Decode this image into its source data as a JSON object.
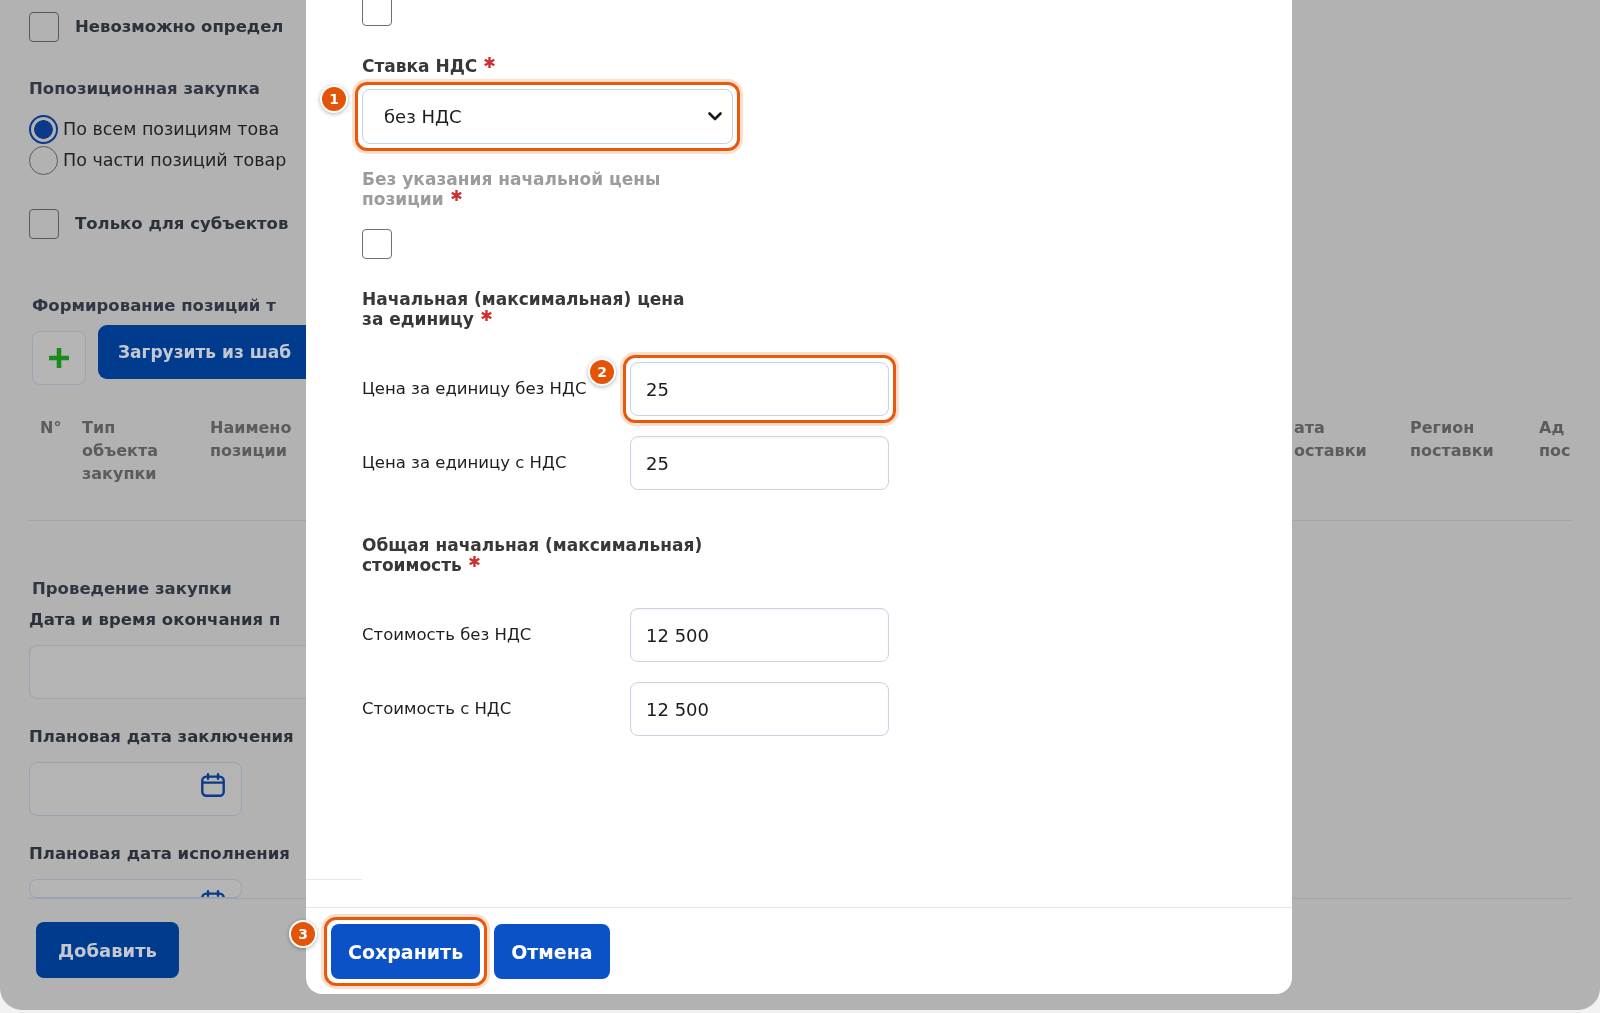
{
  "page": {
    "determination_checkbox": {
      "label": "Невозможно определ",
      "checked": false
    },
    "positional_purchase": {
      "title": "Попозиционная закупка",
      "options": [
        {
          "label": "По всем позициям това",
          "selected": true
        },
        {
          "label": "По части позиций товар",
          "selected": false
        }
      ]
    },
    "smb_checkbox": {
      "label": "Только для субъектов",
      "checked": false
    },
    "positions": {
      "title": "Формирование позиций т",
      "template_button": "Загрузить из шаб",
      "table": {
        "columns": [
          "N°",
          "Тип объекта закупки",
          "Наимено позиции",
          "ата оставки",
          "Регион поставки",
          "Ад пос"
        ]
      }
    },
    "procedure": {
      "title": "Проведение закупки",
      "fields": [
        {
          "kind": "datetime",
          "label": "Дата и время окончания п"
        },
        {
          "kind": "date",
          "label": "Плановая дата заключения"
        },
        {
          "kind": "date",
          "label": "Плановая дата исполнения"
        }
      ]
    },
    "add_button": "Добавить"
  },
  "modal": {
    "fields": [
      {
        "kind": "checkbox",
        "checked": false,
        "disabled": false
      },
      {
        "kind": "select",
        "label": "Ставка НДС",
        "required": true,
        "value": "без НДС",
        "highlighted": true,
        "badge": "1"
      },
      {
        "kind": "checkbox",
        "label": "Без указания начальной цены позиции",
        "required": true,
        "disabled": true,
        "checked": false
      },
      {
        "kind": "group",
        "label": "Начальная (максимальная) цена за единицу",
        "required": true,
        "rows": [
          {
            "label": "Цена за единицу без НДС",
            "value": "25",
            "highlighted": true,
            "badge": "2"
          },
          {
            "label": "Цена за единицу с НДС",
            "value": "25",
            "highlighted": false
          }
        ]
      },
      {
        "kind": "group",
        "label": "Общая начальная (максимальная) стоимость",
        "required": true,
        "rows": [
          {
            "label": "Стоимость без НДС",
            "value": "12 500",
            "highlighted": false
          },
          {
            "label": "Стоимость с НДС",
            "value": "12 500",
            "highlighted": false
          }
        ]
      }
    ],
    "buttons": [
      {
        "label": "Сохранить",
        "highlighted": true,
        "badge": "3"
      },
      {
        "label": "Отмена",
        "highlighted": false
      }
    ]
  }
}
